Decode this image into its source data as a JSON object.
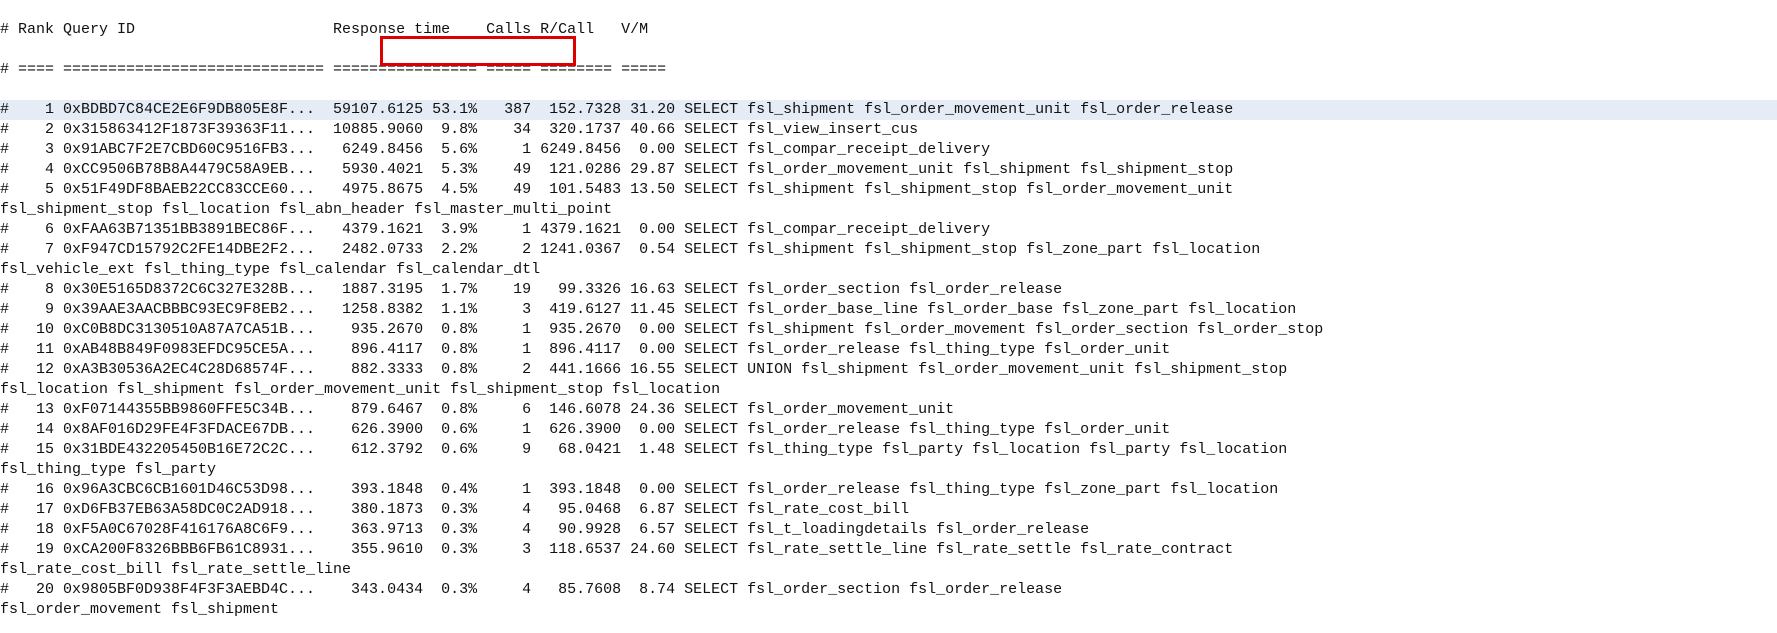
{
  "header": {
    "line1": "# Rank Query ID                      Response time    Calls R/Call   V/M",
    "line2": "# ==== ============================= ================ ===== ======== ====="
  },
  "rows": [
    {
      "rank": 1,
      "qid": "0xBDBD7C84CE2E6F9DB805E8F...",
      "rt": "59107.6125",
      "pct": "53.1%",
      "calls": 387,
      "rcall": "152.7328",
      "vm": "31.20",
      "desc": "SELECT fsl_shipment fsl_order_movement_unit fsl_order_release",
      "highlight": true
    },
    {
      "rank": 2,
      "qid": "0x315863412F1873F39363F11...",
      "rt": "10885.9060",
      "pct": "9.8%",
      "calls": 34,
      "rcall": "320.1737",
      "vm": "40.66",
      "desc": "SELECT fsl_view_insert_cus"
    },
    {
      "rank": 3,
      "qid": "0x91ABC7F2E7CBD60C9516FB3...",
      "rt": "6249.8456",
      "pct": "5.6%",
      "calls": 1,
      "rcall": "6249.8456",
      "vm": "0.00",
      "desc": "SELECT fsl_compar_receipt_delivery"
    },
    {
      "rank": 4,
      "qid": "0xCC9506B78B8A4479C58A9EB...",
      "rt": "5930.4021",
      "pct": "5.3%",
      "calls": 49,
      "rcall": "121.0286",
      "vm": "29.87",
      "desc": "SELECT fsl_order_movement_unit fsl_shipment fsl_shipment_stop"
    },
    {
      "rank": 5,
      "qid": "0x51F49DF8BAEB22CC83CCE60...",
      "rt": "4975.8675",
      "pct": "4.5%",
      "calls": 49,
      "rcall": "101.5483",
      "vm": "13.50",
      "desc": "SELECT fsl_shipment fsl_shipment_stop fsl_order_movement_unit",
      "wrap": "fsl_shipment_stop fsl_location fsl_abn_header fsl_master_multi_point"
    },
    {
      "rank": 6,
      "qid": "0xFAA63B71351BB3891BEC86F...",
      "rt": "4379.1621",
      "pct": "3.9%",
      "calls": 1,
      "rcall": "4379.1621",
      "vm": "0.00",
      "desc": "SELECT fsl_compar_receipt_delivery"
    },
    {
      "rank": 7,
      "qid": "0xF947CD15792C2FE14DBE2F2...",
      "rt": "2482.0733",
      "pct": "2.2%",
      "calls": 2,
      "rcall": "1241.0367",
      "vm": "0.54",
      "desc": "SELECT fsl_shipment fsl_shipment_stop fsl_zone_part fsl_location",
      "wrap": "fsl_vehicle_ext fsl_thing_type fsl_calendar fsl_calendar_dtl"
    },
    {
      "rank": 8,
      "qid": "0x30E5165D8372C6C327E328B...",
      "rt": "1887.3195",
      "pct": "1.7%",
      "calls": 19,
      "rcall": "99.3326",
      "vm": "16.63",
      "desc": "SELECT fsl_order_section fsl_order_release"
    },
    {
      "rank": 9,
      "qid": "0x39AAE3AACBBBC93EC9F8EB2...",
      "rt": "1258.8382",
      "pct": "1.1%",
      "calls": 3,
      "rcall": "419.6127",
      "vm": "11.45",
      "desc": "SELECT fsl_order_base_line fsl_order_base fsl_zone_part fsl_location"
    },
    {
      "rank": 10,
      "qid": "0xC0B8DC3130510A87A7CA51B...",
      "rt": "935.2670",
      "pct": "0.8%",
      "calls": 1,
      "rcall": "935.2670",
      "vm": "0.00",
      "desc": "SELECT fsl_shipment fsl_order_movement fsl_order_section fsl_order_stop"
    },
    {
      "rank": 11,
      "qid": "0xAB48B849F0983EFDC95CE5A...",
      "rt": "896.4117",
      "pct": "0.8%",
      "calls": 1,
      "rcall": "896.4117",
      "vm": "0.00",
      "desc": "SELECT fsl_order_release fsl_thing_type fsl_order_unit"
    },
    {
      "rank": 12,
      "qid": "0xA3B30536A2EC4C28D68574F...",
      "rt": "882.3333",
      "pct": "0.8%",
      "calls": 2,
      "rcall": "441.1666",
      "vm": "16.55",
      "desc": "SELECT UNION fsl_shipment fsl_order_movement_unit fsl_shipment_stop",
      "wrap": "fsl_location fsl_shipment fsl_order_movement_unit fsl_shipment_stop fsl_location"
    },
    {
      "rank": 13,
      "qid": "0xF07144355BB9860FFE5C34B...",
      "rt": "879.6467",
      "pct": "0.8%",
      "calls": 6,
      "rcall": "146.6078",
      "vm": "24.36",
      "desc": "SELECT fsl_order_movement_unit"
    },
    {
      "rank": 14,
      "qid": "0x8AF016D29FE4F3FDACE67DB...",
      "rt": "626.3900",
      "pct": "0.6%",
      "calls": 1,
      "rcall": "626.3900",
      "vm": "0.00",
      "desc": "SELECT fsl_order_release fsl_thing_type fsl_order_unit"
    },
    {
      "rank": 15,
      "qid": "0x31BDE432205450B16E72C2C...",
      "rt": "612.3792",
      "pct": "0.6%",
      "calls": 9,
      "rcall": "68.0421",
      "vm": "1.48",
      "desc": "SELECT fsl_thing_type fsl_party fsl_location fsl_party fsl_location",
      "wrap": "fsl_thing_type fsl_party"
    },
    {
      "rank": 16,
      "qid": "0x96A3CBC6CB1601D46C53D98...",
      "rt": "393.1848",
      "pct": "0.4%",
      "calls": 1,
      "rcall": "393.1848",
      "vm": "0.00",
      "desc": "SELECT fsl_order_release fsl_thing_type fsl_zone_part fsl_location"
    },
    {
      "rank": 17,
      "qid": "0xD6FB37EB63A58DC0C2AD918...",
      "rt": "380.1873",
      "pct": "0.3%",
      "calls": 4,
      "rcall": "95.0468",
      "vm": "6.87",
      "desc": "SELECT fsl_rate_cost_bill"
    },
    {
      "rank": 18,
      "qid": "0xF5A0C67028F416176A8C6F9...",
      "rt": "363.9713",
      "pct": "0.3%",
      "calls": 4,
      "rcall": "90.9928",
      "vm": "6.57",
      "desc": "SELECT fsl_t_loadingdetails fsl_order_release"
    },
    {
      "rank": 19,
      "qid": "0xCA200F8326BBB6FB61C8931...",
      "rt": "355.9610",
      "pct": "0.3%",
      "calls": 3,
      "rcall": "118.6537",
      "vm": "24.60",
      "desc": "SELECT fsl_rate_settle_line fsl_rate_settle fsl_rate_contract",
      "wrap": "fsl_rate_cost_bill fsl_rate_settle_line"
    },
    {
      "rank": 20,
      "qid": "0x9805BF0D938F4F3F3AEBD4C...",
      "rt": "343.0434",
      "pct": "0.3%",
      "calls": 4,
      "rcall": "85.7608",
      "vm": "8.74",
      "desc": "SELECT fsl_order_section fsl_order_release",
      "wrap": "fsl_order_movement fsl_shipment"
    }
  ]
}
